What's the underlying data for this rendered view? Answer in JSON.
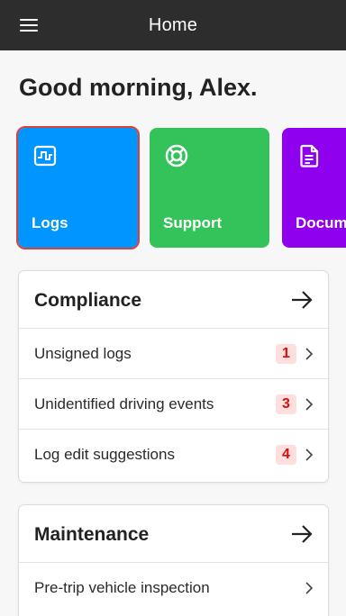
{
  "topbar": {
    "title": "Home",
    "menu_icon": "menu-icon"
  },
  "greeting": "Good morning, Alex.",
  "tiles": [
    {
      "label": "Logs",
      "icon": "logs-icon",
      "color": "#0095ff",
      "selected": true
    },
    {
      "label": "Support",
      "icon": "support-lifebuoy-icon",
      "color": "#33c35a"
    },
    {
      "label": "Documents",
      "icon": "document-icon",
      "color": "#8f00ef"
    }
  ],
  "compliance": {
    "title": "Compliance",
    "items": [
      {
        "label": "Unsigned logs",
        "count": "1"
      },
      {
        "label": "Unidentified driving events",
        "count": "3"
      },
      {
        "label": "Log edit suggestions",
        "count": "4"
      }
    ]
  },
  "maintenance": {
    "title": "Maintenance",
    "items": [
      {
        "label": "Pre-trip vehicle inspection"
      }
    ]
  },
  "colors": {
    "badge_bg": "#ffdede",
    "badge_text": "#d10f0f",
    "topbar": "#2d2d2d",
    "selection_outline": "#d9403a"
  }
}
